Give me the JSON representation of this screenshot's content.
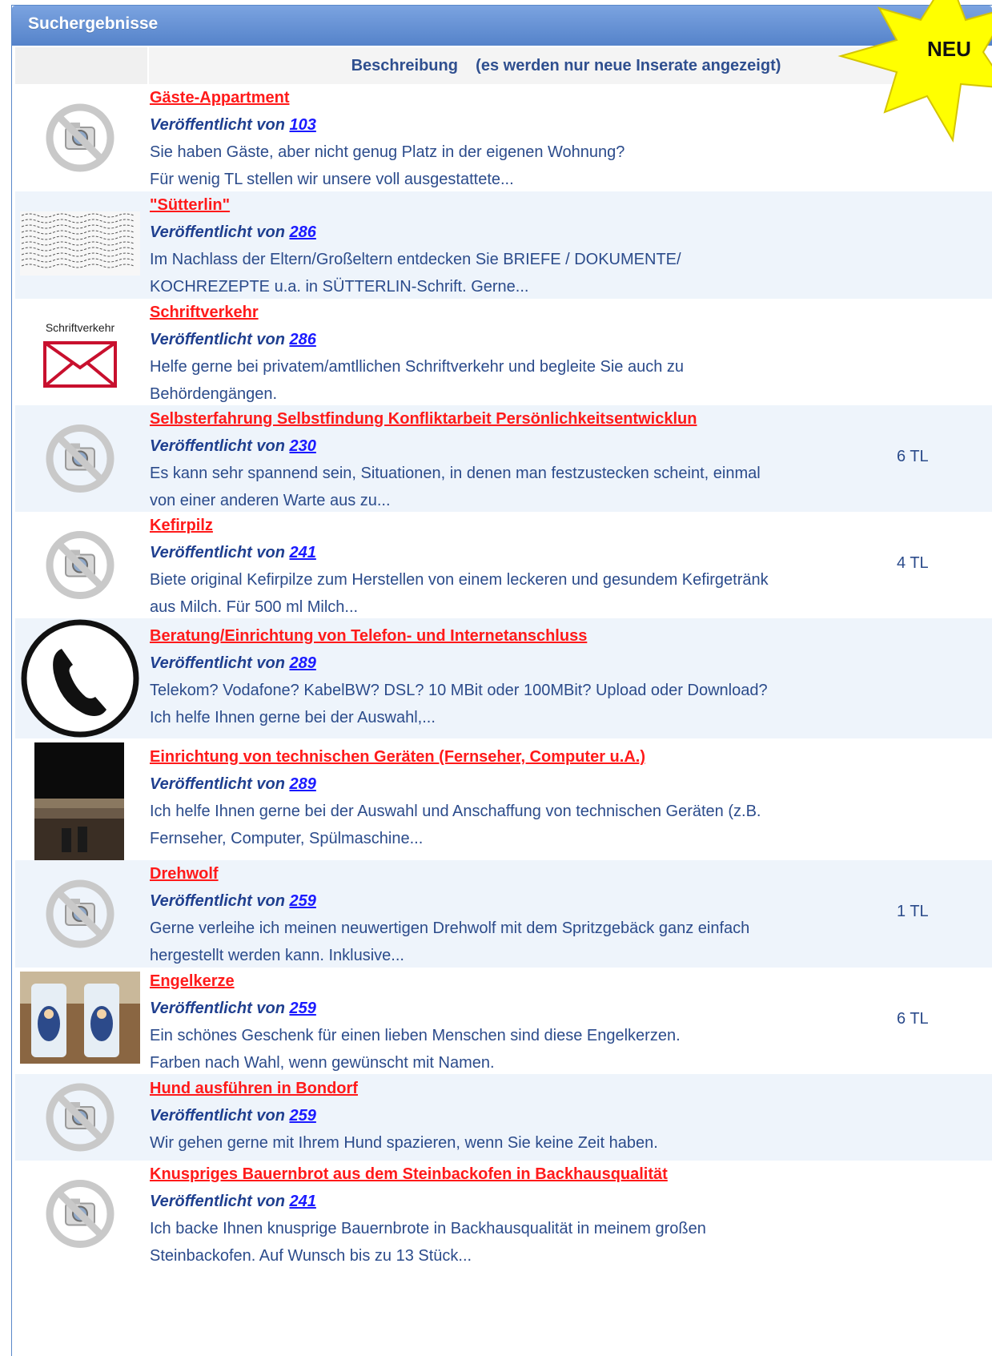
{
  "panel": {
    "title": "Suchergebnisse",
    "column_header": "Beschreibung    (es werden nur neue Inserate angezeigt)",
    "badge": "NEU",
    "colors": {
      "header_bg": "#5583ca",
      "title_link": "#ff1a1a",
      "author_link": "#1a1aff",
      "row_alt": "#eef4fb",
      "badge": "#ffff00"
    }
  },
  "listings": [
    {
      "title": "Gäste-Appartment",
      "published_label": "Veröffentlicht von",
      "author_id": "103",
      "lines": [
        "Sie haben Gäste, aber nicht genug Platz in der eigenen Wohnung?",
        "Für wenig TL stellen wir unsere voll ausgestattete..."
      ],
      "price": "",
      "thumbnail": "no-photo-icon"
    },
    {
      "title": "\"Sütterlin\"",
      "published_label": "Veröffentlicht von",
      "author_id": "286",
      "lines": [
        "Im Nachlass der Eltern/Großeltern entdecken Sie BRIEFE / DOKUMENTE/",
        "KOCHREZEPTE u.a. in SÜTTERLIN-Schrift. Gerne..."
      ],
      "price": "",
      "thumbnail": "handwriting-image"
    },
    {
      "title": "Schriftverkehr",
      "published_label": "Veröffentlicht von",
      "author_id": "286",
      "lines": [
        "Helfe gerne bei privatem/amtllichen Schriftverkehr und begleite Sie auch zu",
        "Behördengängen."
      ],
      "price": "",
      "thumbnail": "envelope-icon",
      "thumbnail_caption": "Schriftverkehr"
    },
    {
      "title": "Selbsterfahrung Selbstfindung Konfliktarbeit Persönlichkeitsentwicklun",
      "published_label": "Veröffentlicht von",
      "author_id": "230",
      "lines": [
        "Es kann sehr spannend sein, Situationen, in denen man festzustecken scheint, einmal",
        "von einer anderen Warte aus zu..."
      ],
      "price": "6 TL",
      "thumbnail": "no-photo-icon"
    },
    {
      "title": "Kefirpilz",
      "published_label": "Veröffentlicht von",
      "author_id": "241",
      "lines": [
        "Biete original Kefirpilze zum Herstellen von einem leckeren und gesundem Kefirgetränk",
        "aus Milch. Für 500 ml Milch..."
      ],
      "price": "4 TL",
      "thumbnail": "no-photo-icon"
    },
    {
      "title": "Beratung/Einrichtung von Telefon- und Internetanschluss",
      "published_label": "Veröffentlicht von",
      "author_id": "289",
      "lines": [
        "Telekom? Vodafone? KabelBW? DSL? 10 MBit oder 100MBit? Upload oder Download?",
        "Ich helfe Ihnen gerne bei der Auswahl,..."
      ],
      "price": "",
      "thumbnail": "phone-icon"
    },
    {
      "title": "Einrichtung von technischen Geräten (Fernseher, Computer u.A.)",
      "published_label": "Veröffentlicht von",
      "author_id": "289",
      "lines": [
        "Ich helfe Ihnen gerne bei der Auswahl und Anschaffung von technischen Geräten (z.B.",
        "Fernseher, Computer, Spülmaschine..."
      ],
      "price": "",
      "thumbnail": "tv-photo"
    },
    {
      "title": "Drehwolf",
      "published_label": "Veröffentlicht von",
      "author_id": "259",
      "lines": [
        "Gerne verleihe ich meinen neuwertigen Drehwolf mit dem Spritzgebäck ganz einfach",
        "hergestellt werden kann. Inklusive..."
      ],
      "price": "1 TL",
      "thumbnail": "no-photo-icon"
    },
    {
      "title": "Engelkerze",
      "published_label": "Veröffentlicht von",
      "author_id": "259",
      "lines": [
        "Ein schönes Geschenk für einen lieben Menschen sind diese Engelkerzen.",
        "Farben nach Wahl, wenn gewünscht mit Namen."
      ],
      "price": "6 TL",
      "thumbnail": "candles-photo"
    },
    {
      "title": "Hund ausführen in Bondorf",
      "published_label": "Veröffentlicht von",
      "author_id": "259",
      "lines": [
        "Wir gehen gerne mit Ihrem Hund spazieren, wenn Sie keine Zeit haben."
      ],
      "price": "",
      "thumbnail": "no-photo-icon"
    },
    {
      "title": "Knuspriges Bauernbrot aus dem Steinbackofen in Backhausqualität",
      "published_label": "Veröffentlicht von",
      "author_id": "241",
      "lines": [
        "Ich backe Ihnen knusprige Bauernbrote in Backhausqualität in meinem großen",
        "Steinbackofen. Auf Wunsch bis zu 13 Stück..."
      ],
      "price": "",
      "thumbnail": "no-photo-icon"
    }
  ]
}
